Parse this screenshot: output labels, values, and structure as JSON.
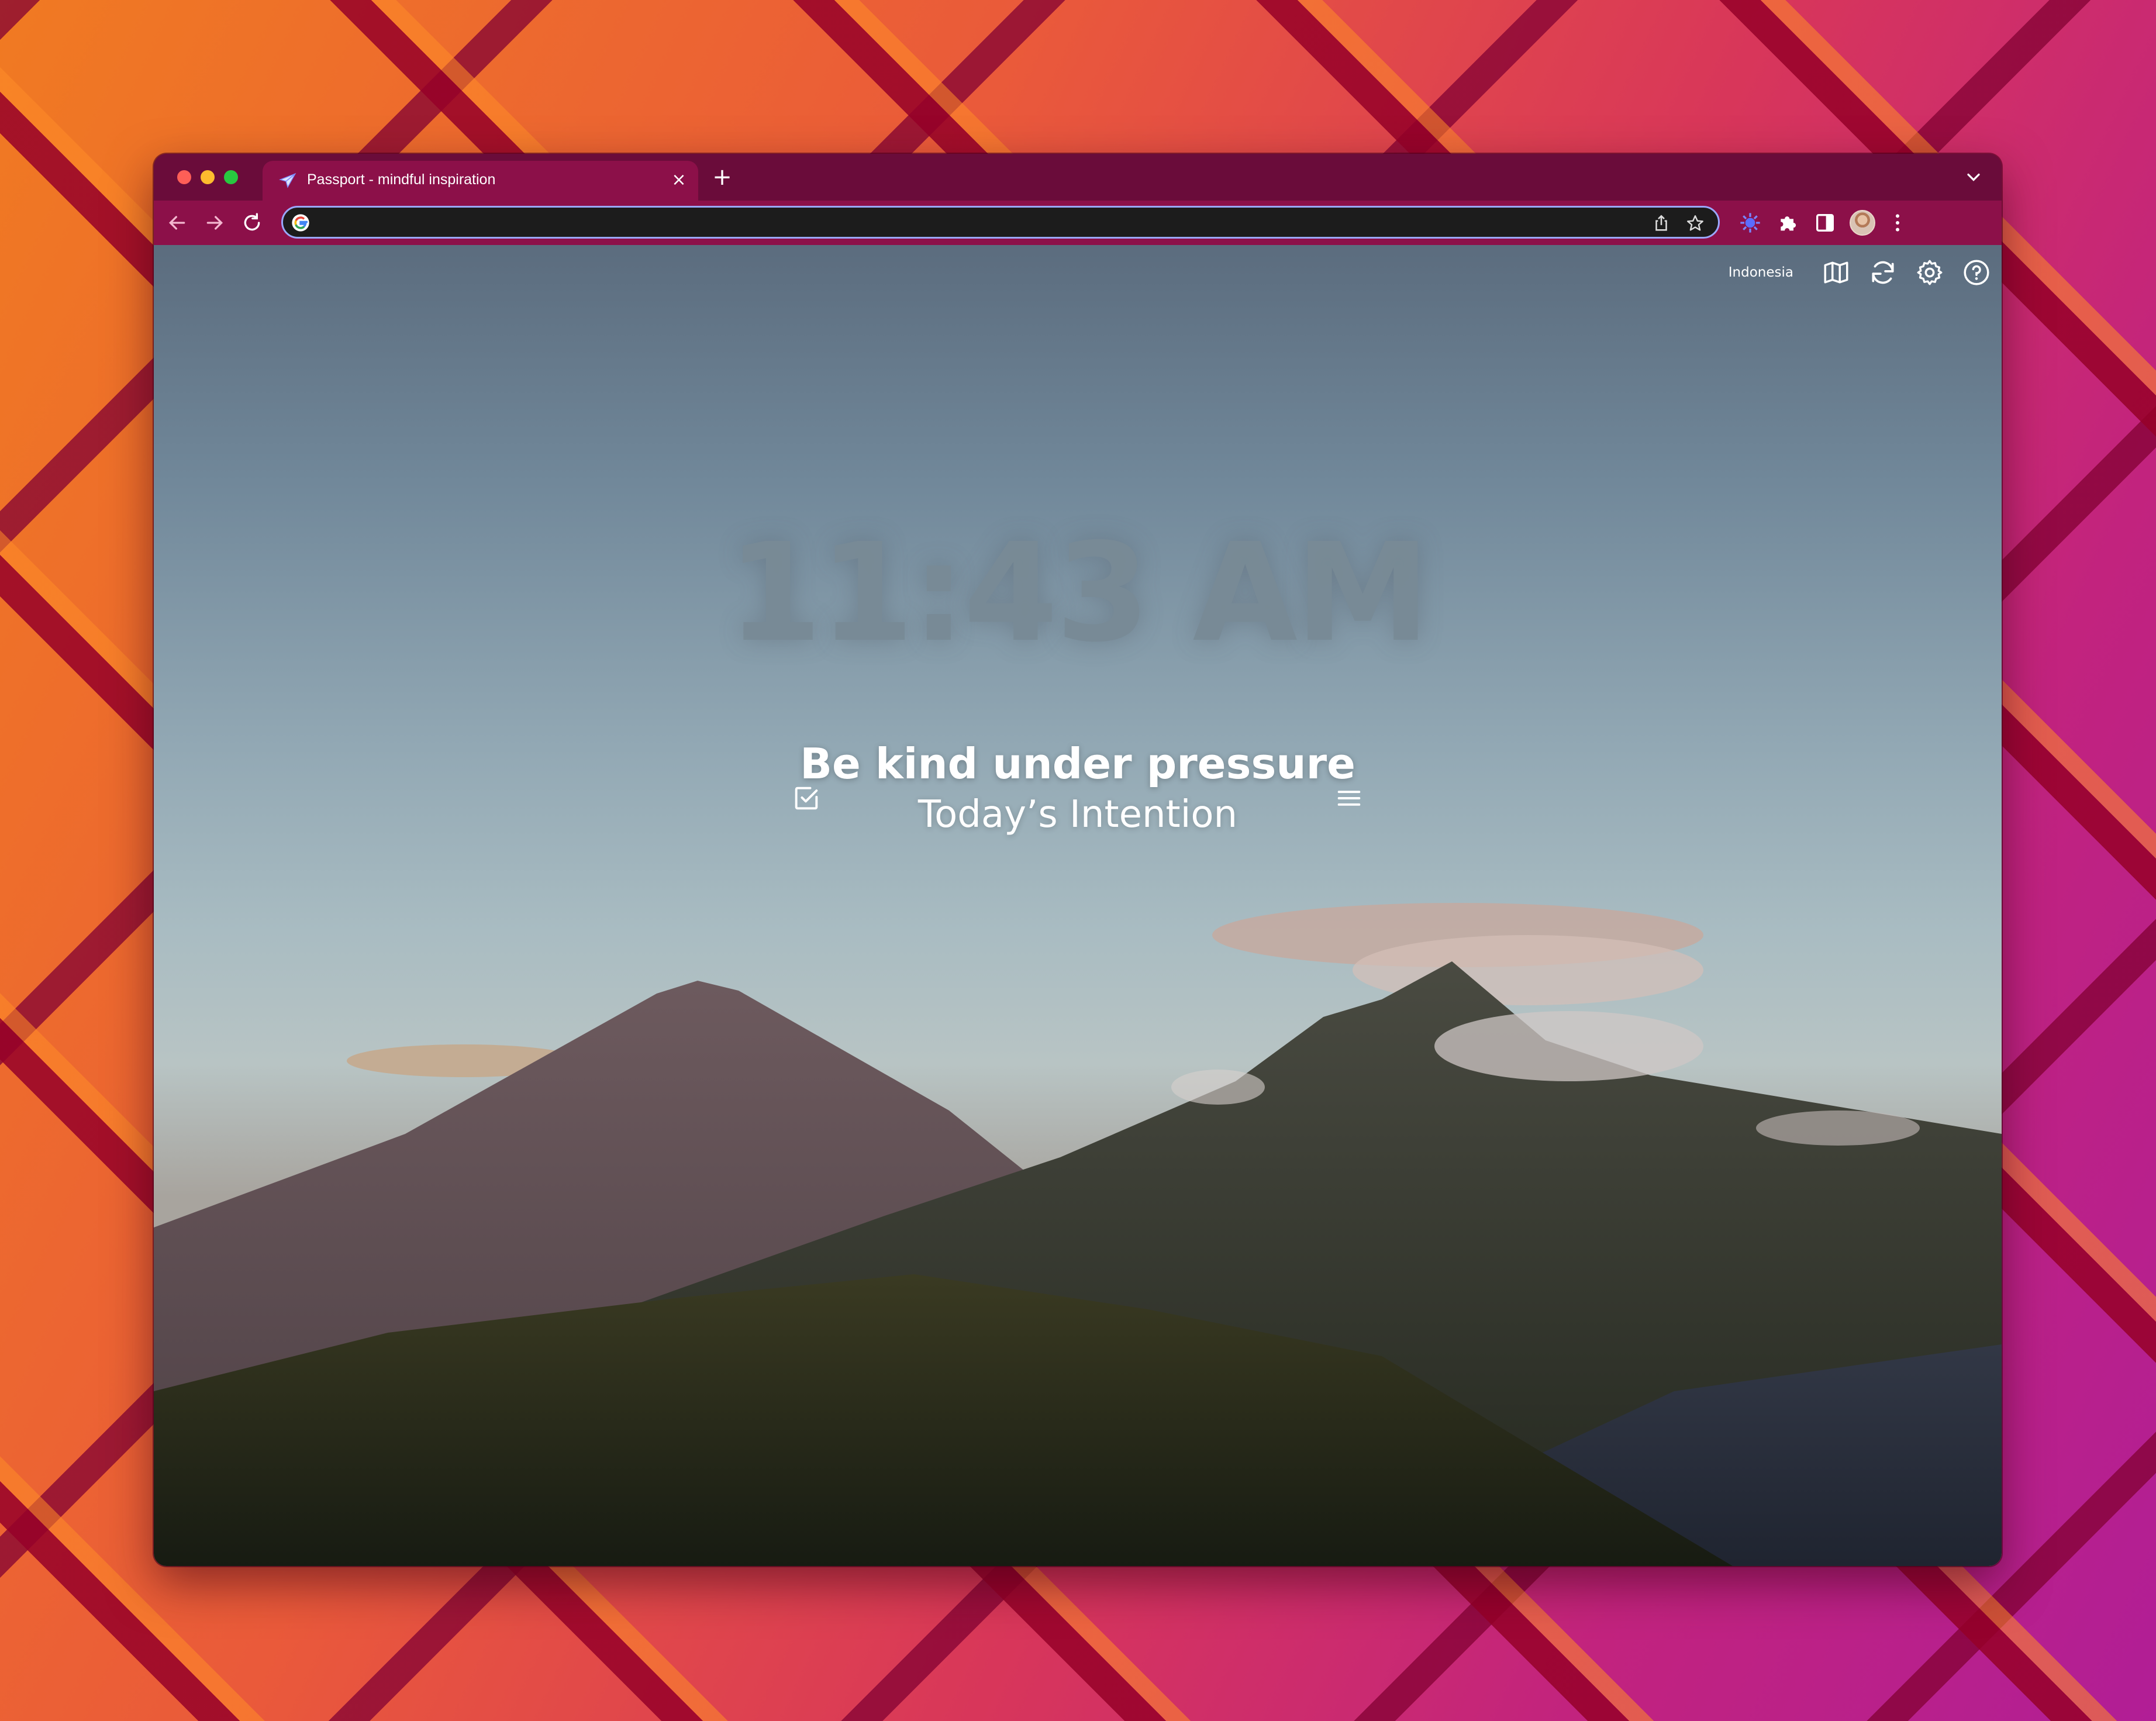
{
  "browser": {
    "tab": {
      "title": "Passport - mindful inspiration",
      "close_icon": "×"
    },
    "new_tab_label": "+",
    "address_bar": {
      "value": "",
      "placeholder": ""
    }
  },
  "page": {
    "location": "Indonesia",
    "clock": "11:43 AM",
    "intention": {
      "title": "Be kind under pressure",
      "subtitle": "Today’s Intention"
    }
  },
  "colors": {
    "tabstrip": "#6a0c3a",
    "toolbar": "#8c1049",
    "omnibox_border": "#9aa8ff"
  },
  "icons": {
    "traffic_lights": [
      "close-icon",
      "minimize-icon",
      "zoom-icon"
    ],
    "toolbar": [
      "back-icon",
      "forward-icon",
      "reload-icon",
      "google-icon",
      "share-icon",
      "star-icon",
      "passport-extension-icon",
      "puzzle-icon",
      "side-panel-icon",
      "avatar",
      "more-icon"
    ],
    "page_top_right": [
      "map-icon",
      "refresh-icon",
      "gear-icon",
      "help-icon"
    ],
    "intention": [
      "checkbox-icon",
      "hamburger-menu-icon"
    ]
  }
}
